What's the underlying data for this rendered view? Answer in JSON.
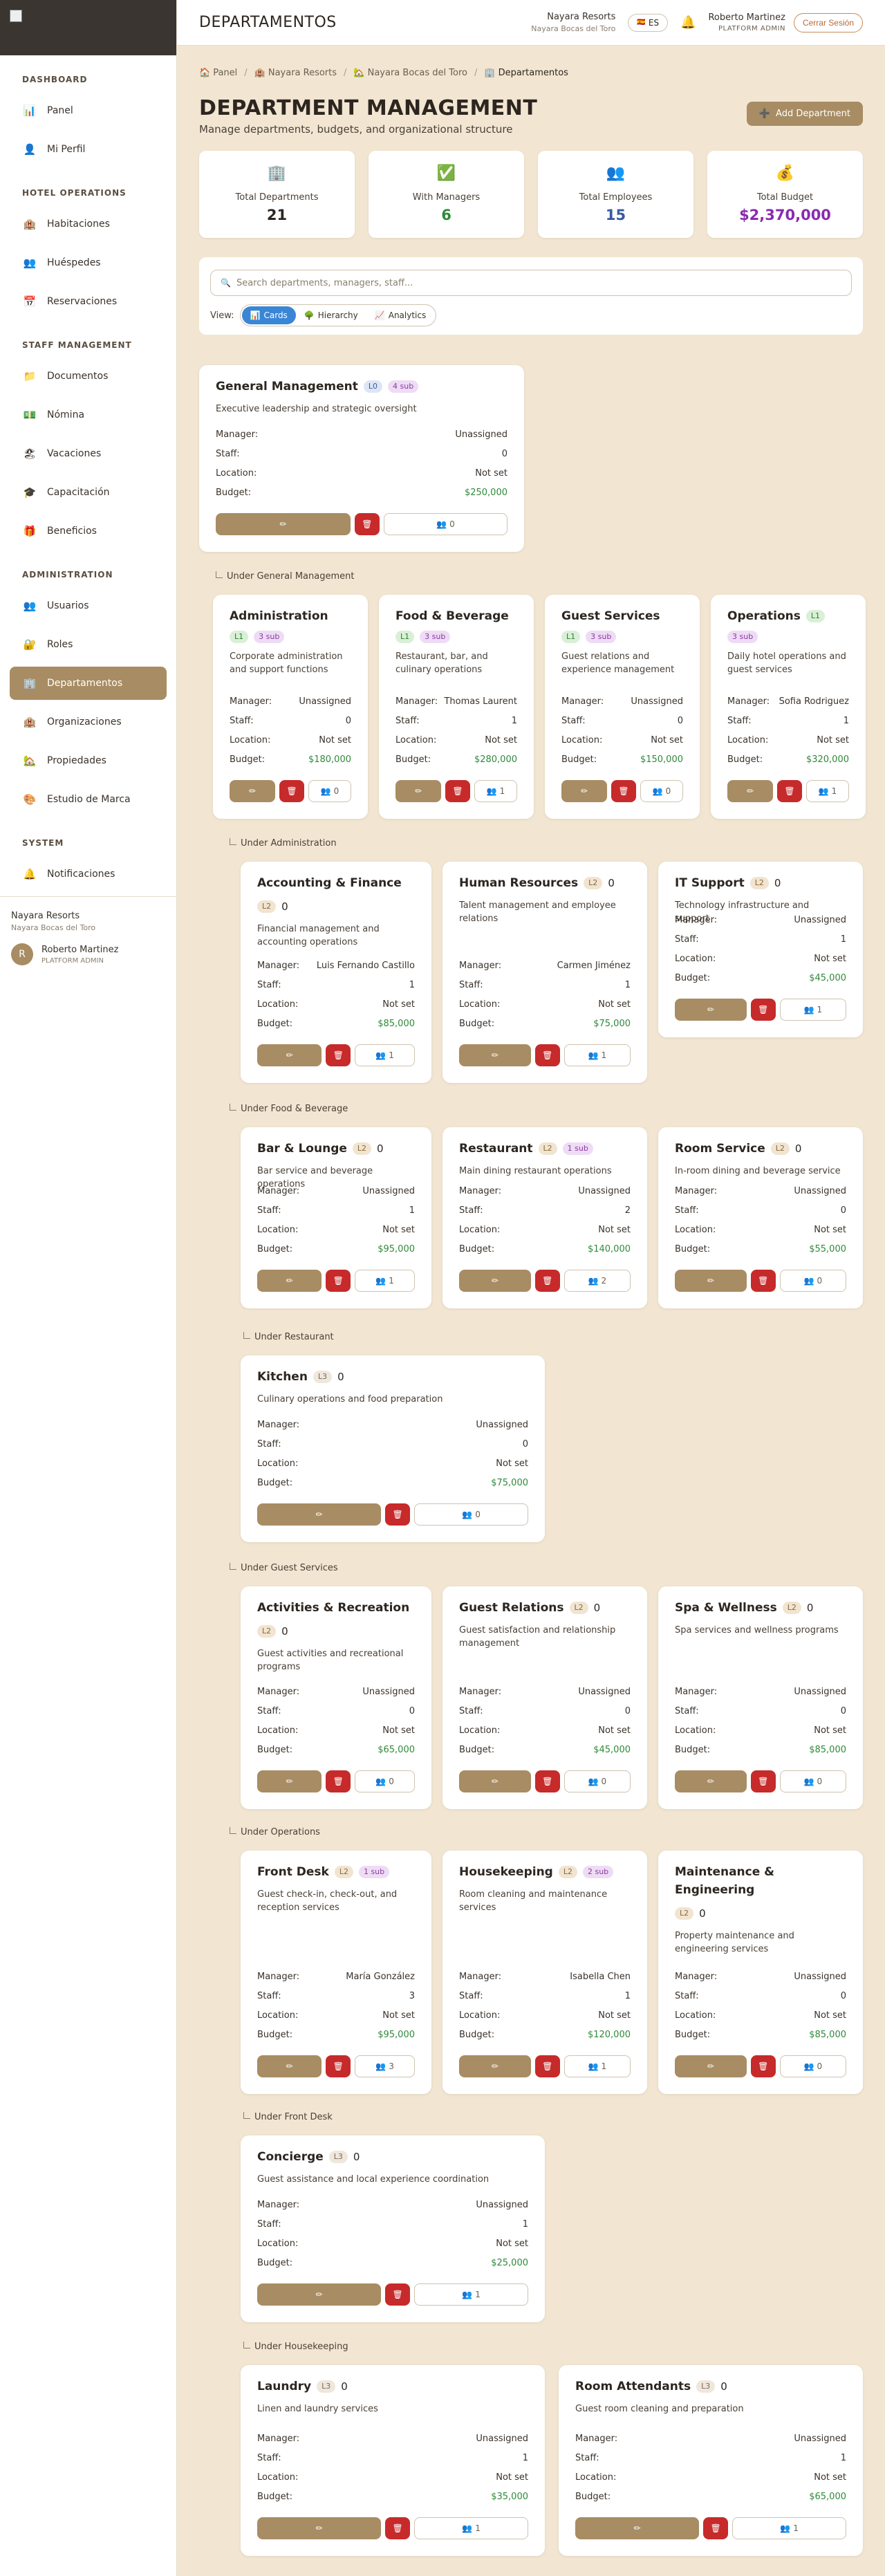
{
  "sidebar": {
    "sections": [
      {
        "title": "DASHBOARD",
        "items": [
          {
            "label": "Panel",
            "icon": "chart-icon"
          },
          {
            "label": "Mi Perfil",
            "icon": "person-icon"
          }
        ]
      },
      {
        "title": "HOTEL OPERATIONS",
        "items": [
          {
            "label": "Habitaciones",
            "icon": "hotel-icon"
          },
          {
            "label": "Huéspedes",
            "icon": "guests-icon"
          },
          {
            "label": "Reservaciones",
            "icon": "calendar-icon"
          }
        ]
      },
      {
        "title": "STAFF MANAGEMENT",
        "items": [
          {
            "label": "Documentos",
            "icon": "folder-icon"
          },
          {
            "label": "Nómina",
            "icon": "money-icon"
          },
          {
            "label": "Vacaciones",
            "icon": "beach-icon"
          },
          {
            "label": "Capacitación",
            "icon": "graduation-icon"
          },
          {
            "label": "Beneficios",
            "icon": "gift-icon"
          }
        ]
      },
      {
        "title": "ADMINISTRATION",
        "items": [
          {
            "label": "Usuarios",
            "icon": "users-icon"
          },
          {
            "label": "Roles",
            "icon": "roles-icon"
          },
          {
            "label": "Departamentos",
            "icon": "building-icon",
            "active": true
          },
          {
            "label": "Organizaciones",
            "icon": "organization-icon"
          },
          {
            "label": "Propiedades",
            "icon": "house-icon"
          },
          {
            "label": "Estudio de Marca",
            "icon": "palette-icon"
          }
        ]
      },
      {
        "title": "SYSTEM",
        "items": [
          {
            "label": "Notificaciones",
            "icon": "bell-icon"
          }
        ]
      }
    ],
    "footer": {
      "org": "Nayara Resorts",
      "property": "Nayara Bocas del Toro",
      "avatar": "R",
      "user": "Roberto Martinez",
      "role": "PLATFORM ADMIN"
    }
  },
  "topbar": {
    "title": "DEPARTAMENTOS",
    "org": "Nayara Resorts",
    "property": "Nayara Bocas del Toro",
    "language": "ES",
    "user": "Roberto Martinez",
    "role": "PLATFORM ADMIN",
    "logout": "Cerrar Sesión"
  },
  "breadcrumb": [
    "Panel",
    "Nayara Resorts",
    "Nayara Bocas del Toro",
    "Departamentos"
  ],
  "header": {
    "title": "DEPARTMENT MANAGEMENT",
    "subtitle": "Manage departments, budgets, and organizational structure",
    "add_button": "Add Department"
  },
  "stats": [
    {
      "label": "Total Departments",
      "value": "21",
      "color": "#2d2620",
      "icon": "building-icon"
    },
    {
      "label": "With Managers",
      "value": "6",
      "color": "#2f8a3a",
      "icon": "check-icon"
    },
    {
      "label": "Total Employees",
      "value": "15",
      "color": "#3a5aa0",
      "icon": "users-icon"
    },
    {
      "label": "Total Budget",
      "value": "$2,370,000",
      "color": "#8a2ab0",
      "icon": "money-bag-icon"
    }
  ],
  "filters": {
    "search_placeholder": "Search departments, managers, staff...",
    "view_label": "View:",
    "views": [
      "Cards",
      "Hierarchy",
      "Analytics"
    ],
    "active_view": "Cards"
  },
  "field_labels": {
    "manager": "Manager:",
    "staff": "Staff:",
    "location": "Location:",
    "budget": "Budget:"
  },
  "groups": [
    {
      "label": "Under General Management"
    },
    {
      "label": "Under Administration"
    },
    {
      "label": "Under Food & Beverage"
    },
    {
      "label": "Under Restaurant"
    },
    {
      "label": "Under Guest Services"
    },
    {
      "label": "Under Operations"
    },
    {
      "label": "Under Front Desk"
    },
    {
      "label": "Under Housekeeping"
    }
  ],
  "departments": [
    {
      "name": "General Management",
      "level": "L0",
      "sub": "4 sub",
      "desc": "Executive leadership and strategic oversight",
      "manager": "Unassigned",
      "staff": "0",
      "location": "Not set",
      "budget": "$250,000",
      "staff_btn": "0"
    },
    {
      "name": "Administration",
      "level": "L1",
      "sub": "3 sub",
      "desc": "Corporate administration and support functions",
      "manager": "Unassigned",
      "staff": "0",
      "location": "Not set",
      "budget": "$180,000",
      "staff_btn": "0"
    },
    {
      "name": "Food & Beverage",
      "level": "L1",
      "sub": "3 sub",
      "desc": "Restaurant, bar, and culinary operations",
      "manager": "Thomas Laurent",
      "staff": "1",
      "location": "Not set",
      "budget": "$280,000",
      "staff_btn": "1"
    },
    {
      "name": "Guest Services",
      "level": "L1",
      "sub": "3 sub",
      "desc": "Guest relations and experience management",
      "manager": "Unassigned",
      "staff": "0",
      "location": "Not set",
      "budget": "$150,000",
      "staff_btn": "0"
    },
    {
      "name": "Operations",
      "level": "L1",
      "sub": "3 sub",
      "desc": "Daily hotel operations and guest services",
      "manager": "Sofia Rodriguez",
      "staff": "1",
      "location": "Not set",
      "budget": "$320,000",
      "staff_btn": "1"
    },
    {
      "name": "Accounting & Finance",
      "level": "L2",
      "zero": "0",
      "desc": "Financial management and accounting operations",
      "manager": "Luis Fernando Castillo",
      "staff": "1",
      "location": "Not set",
      "budget": "$85,000",
      "staff_btn": "1"
    },
    {
      "name": "Human Resources",
      "level": "L2",
      "zero": "0",
      "desc": "Talent management and employee relations",
      "manager": "Carmen Jiménez",
      "staff": "1",
      "location": "Not set",
      "budget": "$75,000",
      "staff_btn": "1"
    },
    {
      "name": "IT Support",
      "level": "L2",
      "zero": "0",
      "desc": "Technology infrastructure and support",
      "manager": "Unassigned",
      "staff": "1",
      "location": "Not set",
      "budget": "$45,000",
      "staff_btn": "1"
    },
    {
      "name": "Bar & Lounge",
      "level": "L2",
      "zero": "0",
      "desc": "Bar service and beverage operations",
      "manager": "Unassigned",
      "staff": "1",
      "location": "Not set",
      "budget": "$95,000",
      "staff_btn": "1"
    },
    {
      "name": "Restaurant",
      "level": "L2",
      "sub": "1 sub",
      "desc": "Main dining restaurant operations",
      "manager": "Unassigned",
      "staff": "2",
      "location": "Not set",
      "budget": "$140,000",
      "staff_btn": "2"
    },
    {
      "name": "Room Service",
      "level": "L2",
      "zero": "0",
      "desc": "In-room dining and beverage service",
      "manager": "Unassigned",
      "staff": "0",
      "location": "Not set",
      "budget": "$55,000",
      "staff_btn": "0"
    },
    {
      "name": "Kitchen",
      "level": "L3",
      "zero": "0",
      "desc": "Culinary operations and food preparation",
      "manager": "Unassigned",
      "staff": "0",
      "location": "Not set",
      "budget": "$75,000",
      "staff_btn": "0"
    },
    {
      "name": "Activities & Recreation",
      "level": "L2",
      "zero": "0",
      "desc": "Guest activities and recreational programs",
      "manager": "Unassigned",
      "staff": "0",
      "location": "Not set",
      "budget": "$65,000",
      "staff_btn": "0"
    },
    {
      "name": "Guest Relations",
      "level": "L2",
      "zero": "0",
      "desc": "Guest satisfaction and relationship management",
      "manager": "Unassigned",
      "staff": "0",
      "location": "Not set",
      "budget": "$45,000",
      "staff_btn": "0"
    },
    {
      "name": "Spa & Wellness",
      "level": "L2",
      "zero": "0",
      "desc": "Spa services and wellness programs",
      "manager": "Unassigned",
      "staff": "0",
      "location": "Not set",
      "budget": "$85,000",
      "staff_btn": "0"
    },
    {
      "name": "Front Desk",
      "level": "L2",
      "sub": "1 sub",
      "desc": "Guest check-in, check-out, and reception services",
      "manager": "María González",
      "staff": "3",
      "location": "Not set",
      "budget": "$95,000",
      "staff_btn": "3"
    },
    {
      "name": "Housekeeping",
      "level": "L2",
      "sub": "2 sub",
      "desc": "Room cleaning and maintenance services",
      "manager": "Isabella Chen",
      "staff": "1",
      "location": "Not set",
      "budget": "$120,000",
      "staff_btn": "1"
    },
    {
      "name": "Maintenance & Engineering",
      "level": "L2",
      "zero": "0",
      "desc": "Property maintenance and engineering services",
      "manager": "Unassigned",
      "staff": "0",
      "location": "Not set",
      "budget": "$85,000",
      "staff_btn": "0"
    },
    {
      "name": "Concierge",
      "level": "L3",
      "zero": "0",
      "desc": "Guest assistance and local experience coordination",
      "manager": "Unassigned",
      "staff": "1",
      "location": "Not set",
      "budget": "$25,000",
      "staff_btn": "1"
    },
    {
      "name": "Laundry",
      "level": "L3",
      "zero": "0",
      "desc": "Linen and laundry services",
      "manager": "Unassigned",
      "staff": "1",
      "location": "Not set",
      "budget": "$35,000",
      "staff_btn": "1"
    },
    {
      "name": "Room Attendants",
      "level": "L3",
      "zero": "0",
      "desc": "Guest room cleaning and preparation",
      "manager": "Unassigned",
      "staff": "1",
      "location": "Not set",
      "budget": "$65,000",
      "staff_btn": "1"
    }
  ]
}
